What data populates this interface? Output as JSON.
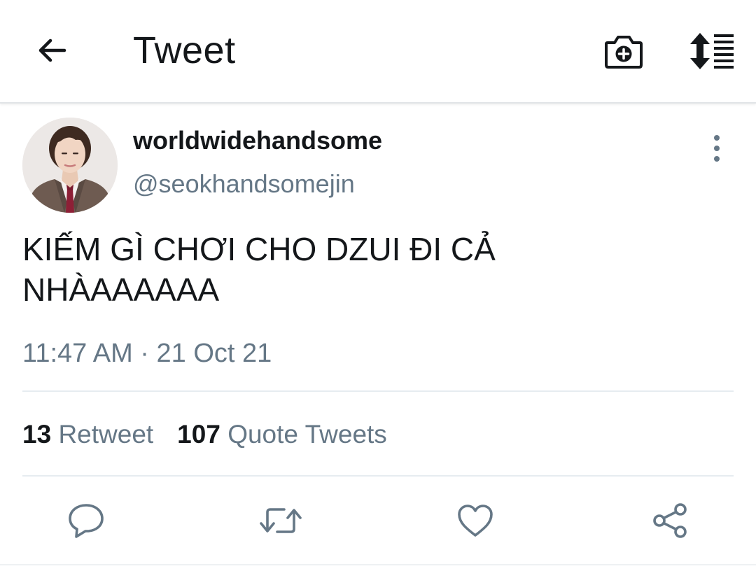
{
  "header": {
    "title": "Tweet",
    "icons": {
      "back": "arrow-left-icon",
      "camera": "camera-plus-icon",
      "sort": "sort-icon"
    }
  },
  "tweet": {
    "display_name": "worldwidehandsome",
    "handle": "@seokhandsomejin",
    "text_lines": [
      "KIẾM GÌ CHƠI CHO DZUI ĐI CẢ",
      "NHÀAAAAAA"
    ],
    "timestamp": "11:47 AM · 21 Oct 21",
    "stats": {
      "retweets_count": "13",
      "retweets_label": "Retweet",
      "quotes_count": "107",
      "quotes_label": "Quote Tweets"
    },
    "actions": [
      "reply-icon",
      "retweet-icon",
      "like-icon",
      "share-icon"
    ]
  },
  "colors": {
    "text_primary": "#14171a",
    "text_secondary": "#657786",
    "divider": "#e6ecf0"
  }
}
